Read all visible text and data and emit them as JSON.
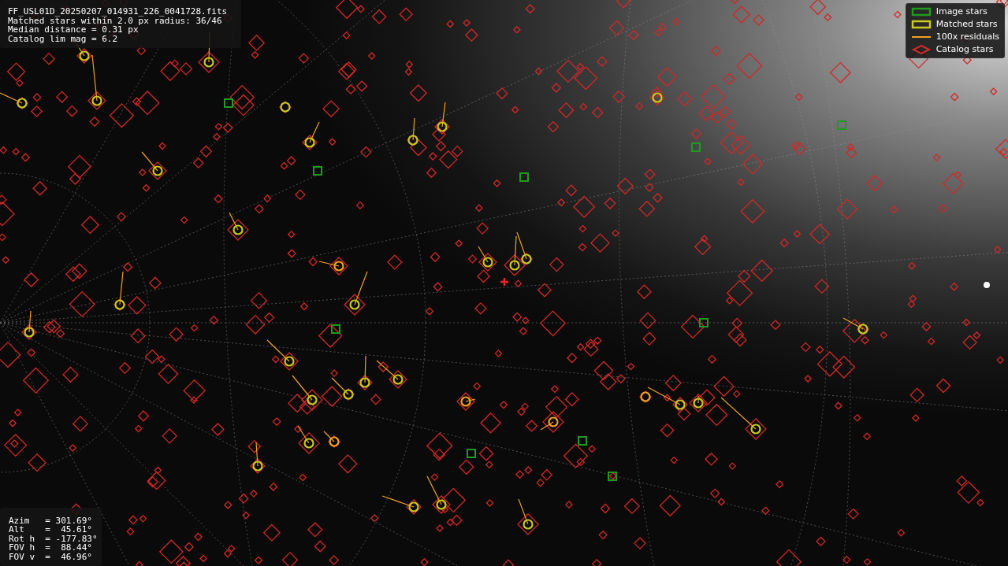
{
  "info_box": {
    "lines": [
      "FF_USL01D_20250207_014931_226_0041728.fits",
      "Matched stars within 2.0 px radius: 36/46",
      "Median distance = 0.31 px",
      "Catalog lim mag = 6.2"
    ]
  },
  "legend": [
    {
      "kind": "square",
      "label": "Image stars",
      "color": "#1f9a1f"
    },
    {
      "kind": "square",
      "label": "Matched stars",
      "color": "#c8c81e"
    },
    {
      "kind": "line",
      "label": "100x residuals",
      "color": "#f0a020"
    },
    {
      "kind": "diamond",
      "label": "Catalog stars",
      "color": "#d22828"
    }
  ],
  "pointing": {
    "lines": [
      "Azim   = 301.69°",
      "Alt    =  45.61°",
      "Rot h  = -177.83°",
      "FOV h  =  88.44°",
      "FOV v  =  46.96°"
    ]
  }
}
